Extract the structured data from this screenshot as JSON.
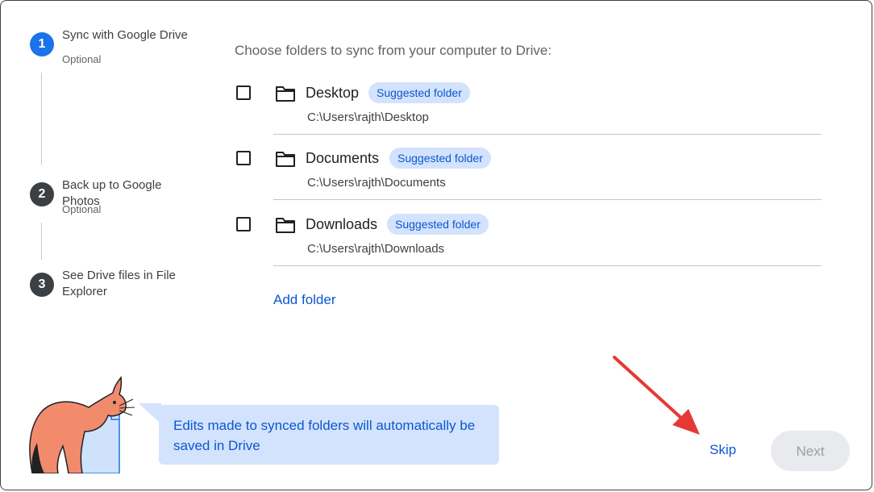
{
  "top_clipped_text": "",
  "steps": [
    {
      "number": "1",
      "title": "Sync with Google Drive",
      "subtitle": "Optional",
      "state": "active"
    },
    {
      "number": "2",
      "title": "Back up to Google Photos",
      "subtitle": "Optional",
      "state": "inactive"
    },
    {
      "number": "3",
      "title": "See Drive files in File Explorer",
      "subtitle": "",
      "state": "inactive"
    }
  ],
  "heading": "Choose folders to sync from your computer to Drive:",
  "folders": [
    {
      "name": "Desktop",
      "badge": "Suggested folder",
      "path": "C:\\Users\\rajth\\Desktop",
      "checked": false
    },
    {
      "name": "Documents",
      "badge": "Suggested folder",
      "path": "C:\\Users\\rajth\\Documents",
      "checked": false
    },
    {
      "name": "Downloads",
      "badge": "Suggested folder",
      "path": "C:\\Users\\rajth\\Downloads",
      "checked": false
    }
  ],
  "add_folder_label": "Add folder",
  "info_message": "Edits made to synced folders will automatically be saved in Drive",
  "buttons": {
    "skip": "Skip",
    "next": "Next"
  },
  "colors": {
    "accent": "#1a73e8",
    "link": "#0b57d0",
    "badge_bg": "#d3e3fd",
    "annotation_arrow": "#e53935"
  }
}
